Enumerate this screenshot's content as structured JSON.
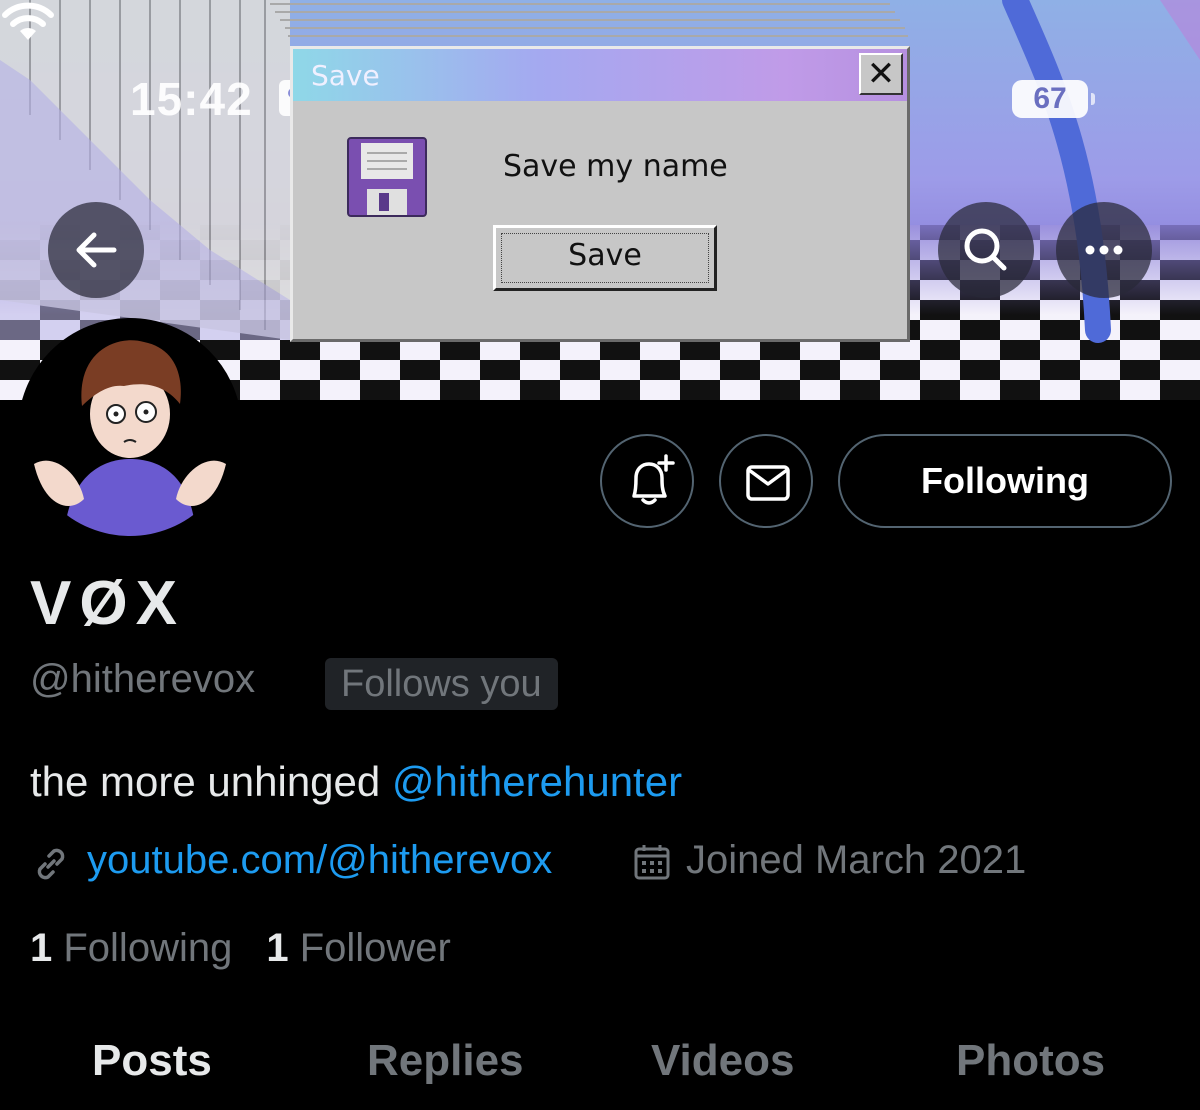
{
  "status_bar": {
    "time": "15:42",
    "battery": "67"
  },
  "banner": {
    "dialog": {
      "title": "Save",
      "close_glyph": "✕",
      "message": "Save my name",
      "save_label": "Save"
    },
    "icons": [
      "back-arrow-icon",
      "search-icon",
      "more-icon",
      "floppy-disk-icon"
    ]
  },
  "profile": {
    "display_name": "VØX",
    "handle": "@hitherevox",
    "follows_you": "Follows you",
    "bio_text": "the more unhinged ",
    "bio_mention": "@hitherehunter",
    "website": "youtube.com/@hitherevox",
    "joined": "Joined March 2021",
    "following_count": "1",
    "following_label": " Following",
    "followers_count": "1",
    "followers_label": " Follower"
  },
  "actions": {
    "following_button": "Following"
  },
  "tabs": [
    {
      "label": "Posts",
      "active": true
    },
    {
      "label": "Replies",
      "active": false
    },
    {
      "label": "Videos",
      "active": false
    },
    {
      "label": "Photos",
      "active": false
    }
  ],
  "colors": {
    "accent": "#1d9bf0",
    "muted": "#71767b",
    "background": "#000000"
  }
}
